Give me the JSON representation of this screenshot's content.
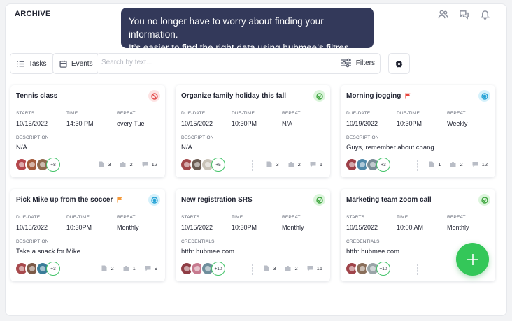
{
  "app": {
    "title": "ARCHIVE"
  },
  "tooltip": {
    "line1": "You no longer have to worry about finding your information.",
    "line2": "It’s easier to find the right data using hubmee’s filtres"
  },
  "header_icons": [
    "people-icon",
    "chat-icon",
    "bell-icon"
  ],
  "toolbar": {
    "tasks_label": "Tasks",
    "events_label": "Events",
    "search_placeholder": "Search by text...",
    "search_value": "",
    "filters_label": "Filters"
  },
  "colors": {
    "accent_green": "#34c759",
    "tooltip_bg": "#33395a",
    "status_cancel": "#e24c4c",
    "status_done": "#3fa53f",
    "status_progress": "#27a3d6",
    "flag_red": "#e8453c",
    "flag_orange": "#f59a3b"
  },
  "cards": [
    {
      "title": "Tennis class",
      "status": "cancelled",
      "flag": "",
      "fields": [
        {
          "label": "STARTS",
          "value": "10/15/2022"
        },
        {
          "label": "TIME",
          "value": "14:30 PM"
        },
        {
          "label": "REPEAT",
          "value": "every Tue"
        }
      ],
      "desc_label": "DESCRIPTION",
      "desc_value": "N/A",
      "avatar_count": "+8",
      "stats": {
        "files": "3",
        "photos": "2",
        "comments": "12"
      }
    },
    {
      "title": "Organize family holiday this fall",
      "status": "done",
      "flag": "",
      "fields": [
        {
          "label": "DUE-DATE",
          "value": "10/15/2022"
        },
        {
          "label": "DUE-TIME",
          "value": "10:30PM"
        },
        {
          "label": "REPEAT",
          "value": "N/A"
        }
      ],
      "desc_label": "DESCRIPTION",
      "desc_value": "N/A",
      "avatar_count": "+5",
      "stats": {
        "files": "3",
        "photos": "2",
        "comments": "1"
      }
    },
    {
      "title": "Morning jogging",
      "status": "in-progress",
      "flag": "red",
      "fields": [
        {
          "label": "DUE-DATE",
          "value": "10/19/2022"
        },
        {
          "label": "DUE-TIME",
          "value": "10:30PM"
        },
        {
          "label": "REPEAT",
          "value": "Weekly"
        }
      ],
      "desc_label": "DESCRIPTION",
      "desc_value": "Guys, remember about chang...",
      "avatar_count": "+3",
      "stats": {
        "files": "1",
        "photos": "2",
        "comments": "12"
      }
    },
    {
      "title": "Pick Mike up from the soccer",
      "status": "in-progress",
      "flag": "orange",
      "fields": [
        {
          "label": "DUE-DATE",
          "value": "10/15/2022"
        },
        {
          "label": "DUE-TIME",
          "value": "10:30PM"
        },
        {
          "label": "REPEAT",
          "value": "Monthly"
        }
      ],
      "desc_label": "DESCRIPTION",
      "desc_value": "Take a snack for Mike ...",
      "avatar_count": "+3",
      "stats": {
        "files": "2",
        "photos": "1",
        "comments": "9"
      }
    },
    {
      "title": "New registration SRS",
      "status": "done",
      "flag": "",
      "fields": [
        {
          "label": "STARTS",
          "value": "10/15/2022"
        },
        {
          "label": "TIME",
          "value": "10:30PM"
        },
        {
          "label": "REPEAT",
          "value": "Monthly"
        }
      ],
      "desc_label": "CREDENTIALS",
      "desc_value": "htth: hubmee.com",
      "avatar_count": "+10",
      "stats": {
        "files": "3",
        "photos": "2",
        "comments": "15"
      }
    },
    {
      "title": "Marketing team zoom call",
      "status": "done",
      "flag": "",
      "fields": [
        {
          "label": "STARTS",
          "value": "10/15/2022"
        },
        {
          "label": "TIME",
          "value": "10:00 AM"
        },
        {
          "label": "REPEAT",
          "value": "Monthly"
        }
      ],
      "desc_label": "CREDENTIALS",
      "desc_value": "htth: hubmee.com",
      "avatar_count": "+10",
      "stats": {
        "files": "",
        "photos": "",
        "comments": ""
      }
    }
  ]
}
